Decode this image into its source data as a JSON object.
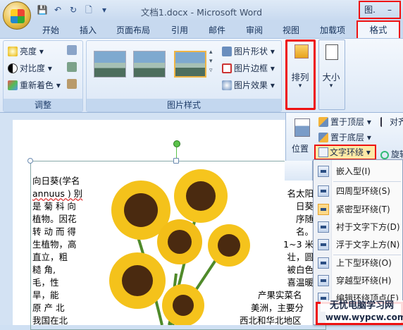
{
  "window": {
    "title": "文档1.docx - Microsoft Word",
    "btn_restore": "图.",
    "btn_minimize": "–"
  },
  "qat": {
    "save": "💾",
    "undo": "↶",
    "redo": "↻",
    "new": "🗋",
    "more": "▾"
  },
  "tabs": [
    "开始",
    "插入",
    "页面布局",
    "引用",
    "邮件",
    "审阅",
    "视图",
    "加载项"
  ],
  "active_tab": "格式",
  "adjust": {
    "brightness": "亮度",
    "contrast": "对比度",
    "recolor": "重新着色",
    "label": "调整"
  },
  "picture_styles": {
    "shape": "图片形状",
    "border": "图片边框",
    "effects": "图片效果",
    "label": "图片样式"
  },
  "arrange": {
    "label": "排列"
  },
  "size": {
    "label": "大小"
  },
  "arrange_panel": {
    "bring_front": "置于顶层",
    "send_back": "置于底层",
    "position": "位置",
    "align": "对齐",
    "rotate": "旋转",
    "text_wrap": "文字环绕"
  },
  "wrap_menu": [
    "嵌入型(I)",
    "四周型环绕(S)",
    "紧密型环绕(T)",
    "衬于文字下方(D)",
    "浮于文字上方(N)",
    "上下型环绕(O)",
    "穿越型环绕(H)",
    "编辑环绕顶点(E)"
  ],
  "doc_left": [
    "向日葵(学名",
    "annuus ) 别",
    "是 菊 科 向",
    "植物。因花",
    "转 动 而 得",
    "生植物，高",
    "直立，粗",
    "糙 角,",
    "毛，性",
    "旱，能",
    "原 产 北",
    "我国在北"
  ],
  "doc_right": [
    "名太阳",
    "日葵",
    "序随",
    "名。",
    "1~3 米",
    "壮，圆",
    "被白色",
    "喜温暖",
    "产果实菜名",
    "美洲，主要分",
    "西北和华北地区"
  ],
  "watermark": {
    "line1": "无忧电脑学习网",
    "line2": "www.wypcw.com"
  }
}
